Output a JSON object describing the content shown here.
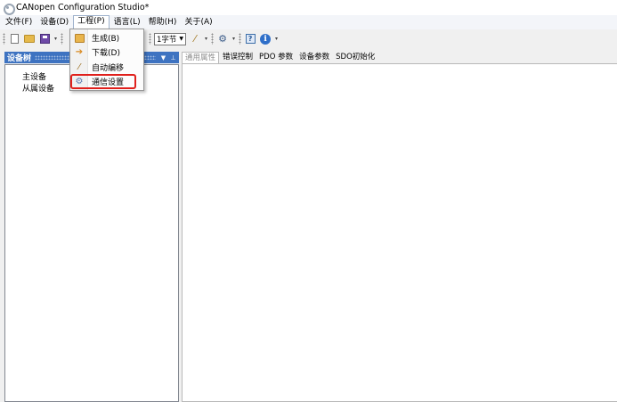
{
  "window": {
    "title": "CANopen Configuration Studio*"
  },
  "menubar": {
    "items": [
      {
        "label": "文件(F)"
      },
      {
        "label": "设备(D)"
      },
      {
        "label": "工程(P)"
      },
      {
        "label": "语言(L)"
      },
      {
        "label": "帮助(H)"
      },
      {
        "label": "关于(A)"
      }
    ]
  },
  "toolbar": {
    "unit_select": "1字节"
  },
  "left_panel": {
    "title": "设备树",
    "tree": [
      {
        "label": "主设备"
      },
      {
        "label": "从属设备"
      }
    ]
  },
  "right_panel": {
    "tabs": [
      {
        "label": "通用属性"
      },
      {
        "label": "错误控制"
      },
      {
        "label": "PDO 参数"
      },
      {
        "label": "设备参数"
      },
      {
        "label": "SDO初始化"
      }
    ]
  },
  "project_menu": {
    "items": [
      {
        "label": "生成(B)",
        "icon": "build-icon"
      },
      {
        "label": "下载(D)",
        "icon": "download-icon"
      },
      {
        "label": "自动编移",
        "icon": "wand-icon"
      },
      {
        "label": "通信设置",
        "icon": "communication-settings-icon"
      }
    ]
  },
  "colors": {
    "panel_header": "#3e73c1",
    "highlight": "#e0201c"
  }
}
